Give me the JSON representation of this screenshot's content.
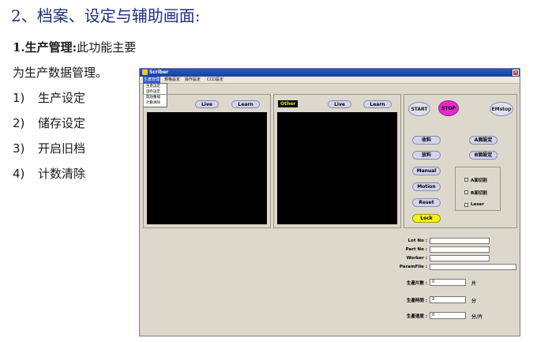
{
  "slide": {
    "heading": "2、档案、设定与辅助画面:",
    "sub_bold": "1.生产管理:",
    "sub_text": "此功能主要",
    "sub_line2": "为生产数据管理。",
    "items": [
      {
        "num": "1)",
        "label": "生产设定"
      },
      {
        "num": "2)",
        "label": "储存设定"
      },
      {
        "num": "3)",
        "label": "开启旧档"
      },
      {
        "num": "4)",
        "label": "计数清除"
      }
    ]
  },
  "app": {
    "title": "Scriber",
    "close": "×",
    "menu": [
      "生產管理",
      "規格設定",
      "操作設定",
      "CCD設定"
    ],
    "dropdown": [
      "生產設定",
      "儲存設定",
      "開啟舊檔",
      "計數清除"
    ],
    "left_panel": {
      "live": "Live",
      "learn": "Learn"
    },
    "right_panel": {
      "label": "Other",
      "live": "Live",
      "learn": "Learn"
    },
    "controls": {
      "start": "START",
      "stop": "STOP",
      "emstop": "EMstop",
      "shou_liao": "收料",
      "a_set": "A面設定",
      "fang_liao": "放料",
      "b_set": "B面設定",
      "manual": "Manual",
      "motion": "Motion",
      "reset": "Reset",
      "lock": "Lock",
      "a_cut": "A面切割",
      "b_cut": "B面切割",
      "laser": "Laser"
    },
    "info": {
      "lot_no": "Lot No  :",
      "part_no": "Part No :",
      "worker": "Worker :",
      "param_file": "ParamFile :",
      "lot_no_val": "",
      "part_no_val": "",
      "worker_val": "",
      "param_file_val": ""
    },
    "stats": [
      {
        "label": "生產片數 :",
        "value": "0",
        "unit": "片"
      },
      {
        "label": "生產時間 :",
        "value": "2",
        "unit": "分"
      },
      {
        "label": "生產速度 :",
        "value": "0",
        "unit": "分/片"
      }
    ]
  }
}
